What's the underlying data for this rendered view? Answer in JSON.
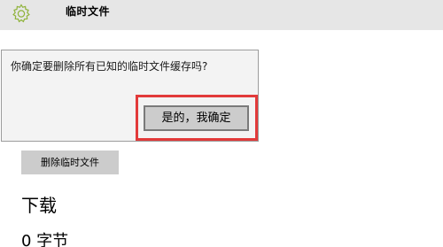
{
  "header": {
    "title": "临时文件",
    "icon": "gear-icon",
    "background": "#e6e6e6"
  },
  "flyout": {
    "message": "你确定要删除所有已知的临时文件缓存吗?",
    "confirm_label": "是的，我确定",
    "highlight_color": "#e23a3a"
  },
  "delete_button": {
    "label": "删除临时文件"
  },
  "downloads": {
    "heading": "下载",
    "size": "0 字节"
  }
}
